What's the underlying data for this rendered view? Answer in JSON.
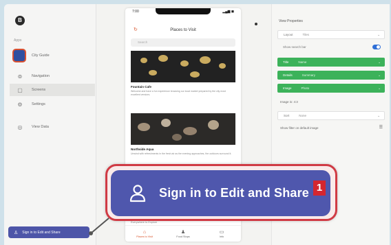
{
  "sidebar": {
    "logo": "B",
    "section_label": "Apps",
    "app_name": "City Guide",
    "nav": [
      {
        "label": "Navigation",
        "icon": "compass-icon",
        "glyph": "⊚"
      },
      {
        "label": "Screens",
        "icon": "screen-icon",
        "glyph": "▢"
      },
      {
        "label": "Settings",
        "icon": "gear-icon",
        "glyph": "⚙"
      },
      {
        "label": "View Data",
        "icon": "database-icon",
        "glyph": "◎"
      }
    ],
    "signin_small": "Sign in to Edit and Share"
  },
  "phone": {
    "time": "7:00",
    "signal": "▂▄▆ ◼",
    "title": "Places to Visit",
    "search_placeholder": "Search",
    "cards": [
      {
        "title": "Fountain Cafe",
        "desc": "Welcome and have a fun experience browsing our local market prepared by the city most excellent vendors."
      },
      {
        "title": "Northside Aqua",
        "desc": "Unwind with refreshments in the fresh air as the evening approaches, the outdoors surround it."
      }
    ],
    "below_label": "Everywhere to Explore",
    "tabs": [
      {
        "label": "Places to Visit",
        "icon": "home-icon",
        "glyph": "⌂",
        "active": true
      },
      {
        "label": "Food Stops",
        "icon": "person-icon",
        "glyph": "♟",
        "active": false
      },
      {
        "label": "Info",
        "icon": "info-icon",
        "glyph": "▭",
        "active": false
      }
    ]
  },
  "panel": {
    "title": "View Properties",
    "layout": {
      "label": "Layout",
      "value": "Tiles"
    },
    "show_search": "Show search bar",
    "green_rows": [
      {
        "label": "Title",
        "value": "Name"
      },
      {
        "label": "Details",
        "value": "Summary"
      },
      {
        "label": "Image",
        "value": "Photo"
      }
    ],
    "image_size": "Image is: 4:3",
    "sort": {
      "label": "Sort",
      "value": "None"
    },
    "filter": "Show filter on default image"
  },
  "callout": {
    "label": "Sign in to Edit and Share",
    "badge": "1"
  },
  "colors": {
    "accent": "#4f57ad",
    "highlight": "#d03a44",
    "green": "#3cb25a",
    "brand": "#d9542c"
  }
}
